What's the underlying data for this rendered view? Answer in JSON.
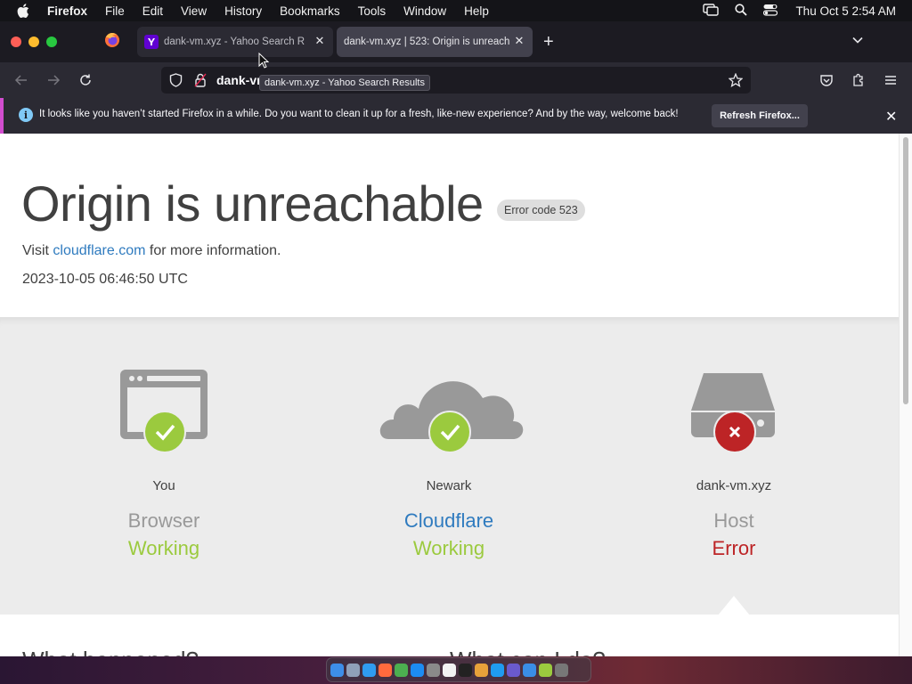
{
  "menubar": {
    "app_name": "Firefox",
    "items": [
      "File",
      "Edit",
      "View",
      "History",
      "Bookmarks",
      "Tools",
      "Window",
      "Help"
    ],
    "clock": "Thu Oct 5  2:54 AM"
  },
  "tabs": [
    {
      "title": "dank-vm.xyz - Yahoo Search R",
      "favicon": "yahoo-icon",
      "active": false
    },
    {
      "title": "dank-vm.xyz | 523: Origin is unreach",
      "favicon": "none",
      "active": true
    }
  ],
  "urlbar": {
    "url": "dank-vm",
    "tooltip": "dank-vm.xyz - Yahoo Search Results"
  },
  "notification": {
    "message": "It looks like you haven’t started Firefox in a while. Do you want to clean it up for a fresh, like-new experience? And by the way, welcome back!",
    "button": "Refresh Firefox..."
  },
  "page": {
    "heading": "Origin is unreachable",
    "error_badge": "Error code 523",
    "visit_prefix": "Visit",
    "visit_link": "cloudflare.com",
    "visit_suffix": "for more information.",
    "timestamp": "2023-10-05 06:46:50 UTC",
    "status": [
      {
        "location": "You",
        "name": "Browser",
        "status": "Working",
        "icon": "browser-icon",
        "state": "ok"
      },
      {
        "location": "Newark",
        "name": "Cloudflare",
        "status": "Working",
        "icon": "cloud-icon",
        "state": "ok"
      },
      {
        "location": "dank-vm.xyz",
        "name": "Host",
        "status": "Error",
        "icon": "server-icon",
        "state": "error"
      }
    ],
    "bottom_left": "What happened?",
    "bottom_right": "What can I do?"
  },
  "colors": {
    "working": "#9bca3e",
    "error": "#bd2426",
    "link": "#2f7bbf",
    "notice_accent": "#d24dcf"
  }
}
